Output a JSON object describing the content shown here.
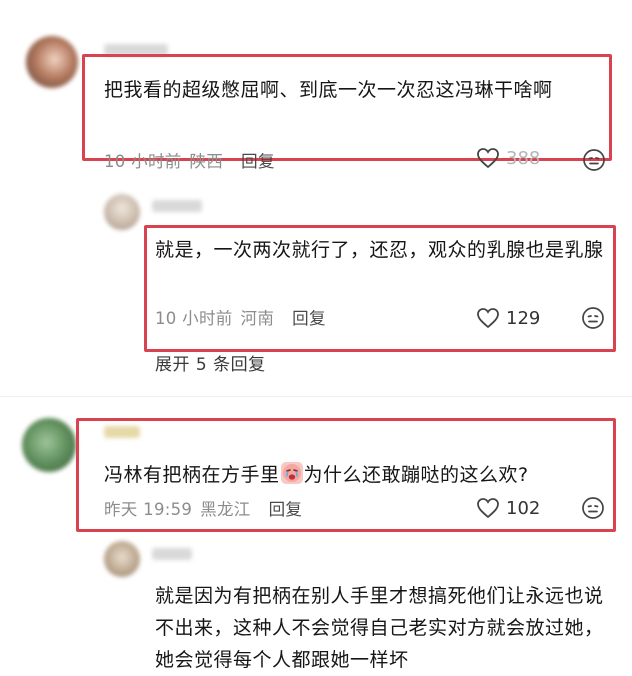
{
  "comments": [
    {
      "text": "把我看的超级憋屈啊、到底一次一次忍这冯琳干啥啊",
      "time": "10 小时前",
      "region": "陕西",
      "reply_label": "回复",
      "likes": "388"
    },
    {
      "text": "就是，一次两次就行了，还忍，观众的乳腺也是乳腺",
      "time": "10 小时前",
      "region": "河南",
      "reply_label": "回复",
      "likes": "129",
      "expand_label": "展开 5 条回复"
    },
    {
      "text_before": "冯林有把柄在方手里",
      "text_after": "为什么还敢蹦哒的这么欢?",
      "time": "昨天 19:59",
      "region": "黑龙江",
      "reply_label": "回复",
      "likes": "102"
    },
    {
      "text": "就是因为有把柄在别人手里才想搞死他们让永远也说不出来，这种人不会觉得自己老实对方就会放过她，她会觉得每个人都跟她一样坏"
    }
  ],
  "colors": {
    "highlight": "#d8434f",
    "meta": "#8c8c8c"
  },
  "icons": [
    "heart-icon",
    "dislike-face-icon",
    "crying-face-emoji"
  ]
}
